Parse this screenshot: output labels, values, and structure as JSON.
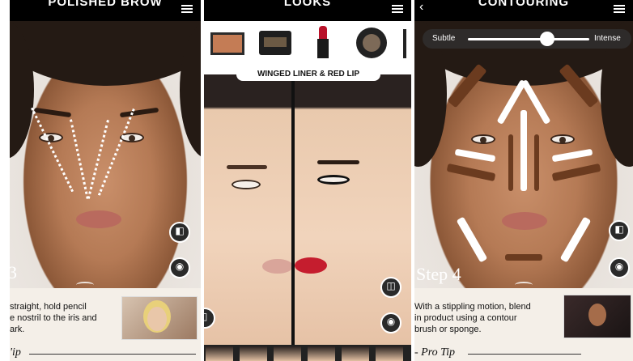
{
  "screens": [
    {
      "title": "POLISHED BROW",
      "step_label": "3",
      "caption": "straight, hold pencil\ne nostril to the iris and\nark.",
      "protip": "'ip"
    },
    {
      "title": "LOOKS",
      "look_name": "WINGED LINER & RED LIP",
      "products": [
        "bronzer-compact",
        "eyeshadow-palette",
        "lipstick",
        "eyeshadow-pot",
        "brush"
      ]
    },
    {
      "title": "CONTOURING",
      "slider": {
        "min_label": "Subtle",
        "max_label": "Intense",
        "value": 0.65
      },
      "step_label": "Step 4",
      "caption": "With a stippling motion, blend\nin product using a contour\nbrush or sponge.",
      "protip": "- Pro Tip"
    }
  ],
  "icons": {
    "menu": "hamburger-icon",
    "back": "chevron-left-icon",
    "compare": "split-view-icon",
    "camera": "camera-icon"
  },
  "colors": {
    "bar": "#000000",
    "contour_light": "#ffffff",
    "contour_dark": "#6b3b1f"
  }
}
